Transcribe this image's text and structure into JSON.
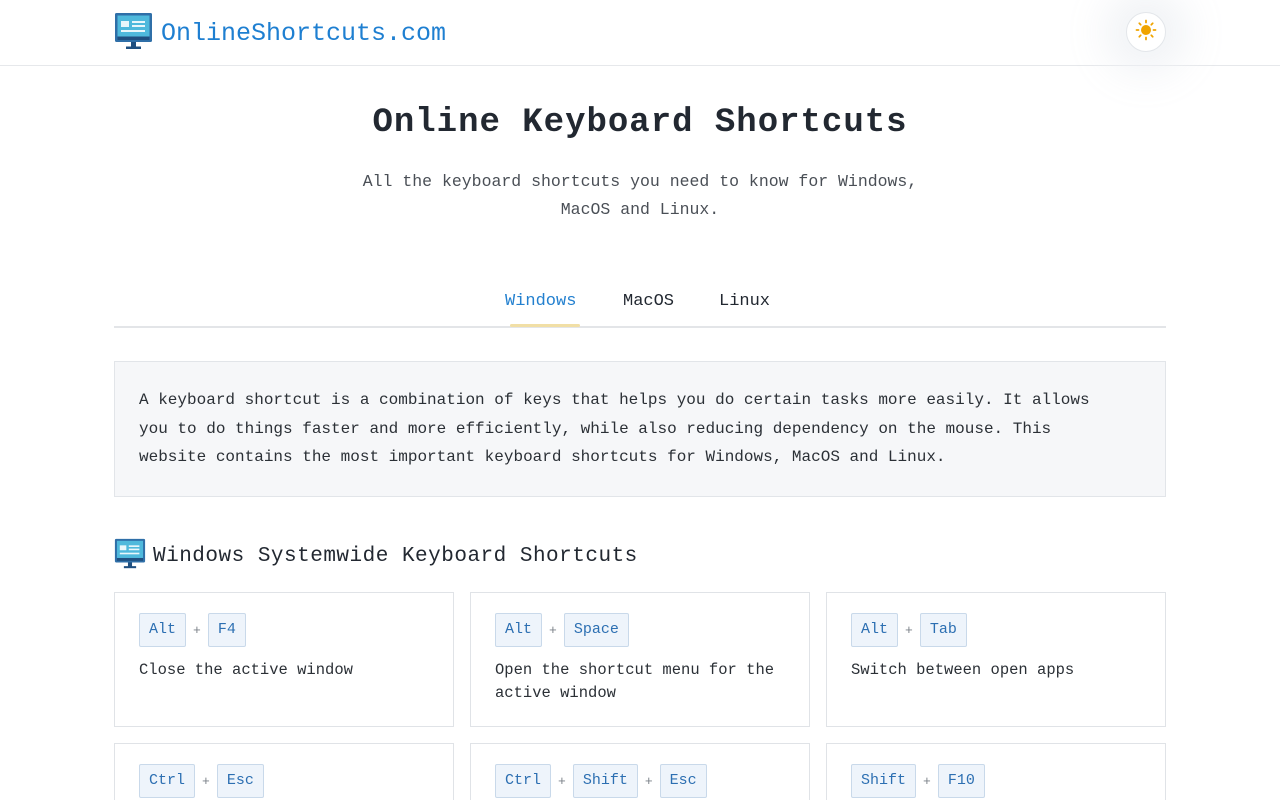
{
  "site": {
    "name": "OnlineShortcuts.com",
    "brand_color": "#1e7fd1"
  },
  "theme_toggle": {
    "icon": "sun-icon",
    "color": "#f0a400"
  },
  "hero": {
    "title": "Online Keyboard Shortcuts",
    "subtitle_line1": "All the keyboard shortcuts you need to know for Windows,",
    "subtitle_line2": "MacOS and Linux."
  },
  "tabs": [
    {
      "label": "Windows",
      "active": true
    },
    {
      "label": "MacOS",
      "active": false
    },
    {
      "label": "Linux",
      "active": false
    }
  ],
  "intro": {
    "line1": "A keyboard shortcut is a combination of keys that helps you do certain tasks more easily. It allows",
    "line2": "you to do things faster and more efficiently, while also reducing dependency on the mouse. This",
    "line3": "website contains the most important keyboard shortcuts for Windows, MacOS and Linux."
  },
  "section": {
    "title": "Windows Systemwide Keyboard Shortcuts",
    "icon": "monitor-icon"
  },
  "shortcuts": [
    {
      "keys": [
        "Alt",
        "F4"
      ],
      "description": "Close the active window"
    },
    {
      "keys": [
        "Alt",
        "Space"
      ],
      "description": "Open the shortcut menu for the active window"
    },
    {
      "keys": [
        "Alt",
        "Tab"
      ],
      "description": "Switch between open apps"
    },
    {
      "keys": [
        "Ctrl",
        "Esc"
      ],
      "description": ""
    },
    {
      "keys": [
        "Ctrl",
        "Shift",
        "Esc"
      ],
      "description": ""
    },
    {
      "keys": [
        "Shift",
        "F10"
      ],
      "description": ""
    }
  ],
  "plus_sign": "+"
}
